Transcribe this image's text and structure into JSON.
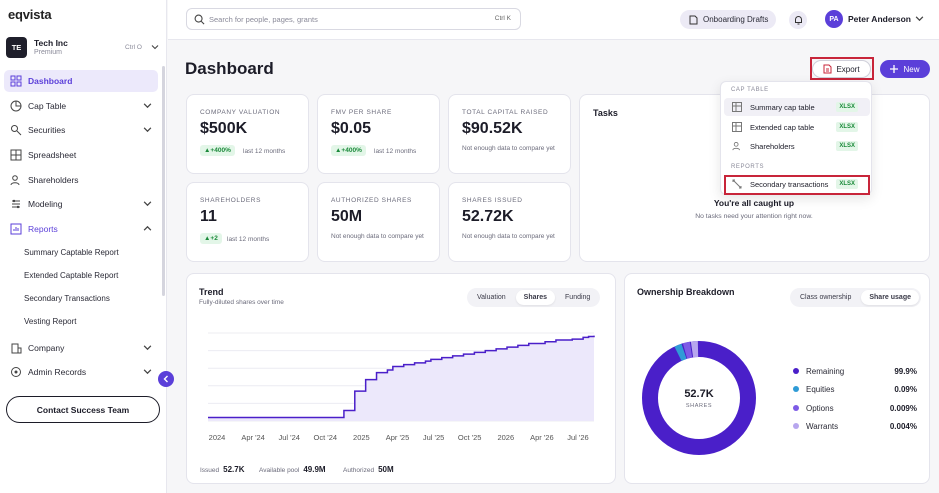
{
  "brand": {
    "logo": "eqvista"
  },
  "company": {
    "initials": "TE",
    "name": "Tech Inc",
    "plan": "Premium",
    "shortcut": "Ctrl O"
  },
  "nav": {
    "items": [
      "Dashboard",
      "Cap Table",
      "Securities",
      "Spreadsheet",
      "Shareholders",
      "Modeling",
      "Reports",
      "Company",
      "Admin Records"
    ],
    "reports_sub": [
      "Summary Captable Report",
      "Extended Captable Report",
      "Secondary Transactions",
      "Vesting Report"
    ],
    "contact": "Contact Success Team"
  },
  "search": {
    "placeholder": "Search for people, pages, grants",
    "shortcut": "Ctrl K"
  },
  "topbar": {
    "onboarding": "Onboarding Drafts",
    "user_initials": "PA",
    "user_name": "Peter Anderson"
  },
  "page": {
    "title": "Dashboard",
    "export": "Export",
    "new": "New"
  },
  "stats": [
    {
      "label": "COMPANY VALUATION",
      "value": "$500K",
      "badge": "▲+400%",
      "note": "last 12 months"
    },
    {
      "label": "FMV PER SHARE",
      "value": "$0.05",
      "badge": "▲+400%",
      "note": "last 12 months"
    },
    {
      "label": "TOTAL CAPITAL RAISED",
      "value": "$90.52K",
      "note": "Not enough data to compare yet"
    },
    {
      "label": "SHAREHOLDERS",
      "value": "11",
      "badge": "▲+2",
      "note": "last 12 months"
    },
    {
      "label": "AUTHORIZED SHARES",
      "value": "50M",
      "note": "Not enough data to compare yet"
    },
    {
      "label": "SHARES ISSUED",
      "value": "52.72K",
      "note": "Not enough data to compare yet"
    }
  ],
  "tasks": {
    "title": "Tasks",
    "empty_title": "You're all caught up",
    "empty_sub": "No tasks need your attention right now."
  },
  "export_menu": {
    "group1": "CAP TABLE",
    "items1": [
      {
        "label": "Summary cap table",
        "fmt": "XLSX"
      },
      {
        "label": "Extended cap table",
        "fmt": "XLSX"
      },
      {
        "label": "Shareholders",
        "fmt": "XLSX"
      }
    ],
    "group2": "REPORTS",
    "items2": [
      {
        "label": "Secondary transactions",
        "fmt": "XLSX"
      }
    ]
  },
  "trend": {
    "title": "Trend",
    "subtitle": "Fully-diluted shares over time",
    "tabs": [
      "Valuation",
      "Shares",
      "Funding"
    ],
    "active_tab": "Shares",
    "footer": [
      {
        "label": "Issued",
        "value": "52.7K"
      },
      {
        "label": "Available pool",
        "value": "49.9M"
      },
      {
        "label": "Authorized",
        "value": "50M"
      }
    ]
  },
  "ownership": {
    "title": "Ownership Breakdown",
    "tabs": [
      "Class ownership",
      "Share usage"
    ],
    "active_tab": "Share usage",
    "center_value": "52.7K",
    "center_label": "SHARES",
    "legend": [
      {
        "name": "Remaining",
        "pct": "99.9%",
        "color": "#4a1fc9"
      },
      {
        "name": "Equities",
        "pct": "0.09%",
        "color": "#2f9bd6"
      },
      {
        "name": "Options",
        "pct": "0.009%",
        "color": "#7d5be6"
      },
      {
        "name": "Warrants",
        "pct": "0.004%",
        "color": "#b7a6ee"
      }
    ]
  },
  "chart_data": {
    "type": "area",
    "x_ticks": [
      "2024",
      "Apr '24",
      "Jul '24",
      "Oct '24",
      "2025",
      "Apr '25",
      "Jul '25",
      "Oct '25",
      "2026",
      "Apr '26",
      "Jul '26"
    ],
    "series": [
      {
        "values": [
          0.04,
          0.04,
          0.04,
          0.04,
          0.04,
          0.04,
          0.04,
          0.04,
          0.04,
          0.04,
          0.04,
          0.04,
          0.04,
          0.04,
          0.04,
          0.04,
          0.04,
          0.04,
          0.04,
          0.04,
          0.04,
          0.04,
          0.04,
          0.04,
          0.04,
          0.12,
          0.12,
          0.34,
          0.34,
          0.47,
          0.47,
          0.55,
          0.55,
          0.58,
          0.62,
          0.62,
          0.64,
          0.64,
          0.66,
          0.66,
          0.68,
          0.7,
          0.7,
          0.72,
          0.72,
          0.74,
          0.74,
          0.76,
          0.76,
          0.78,
          0.78,
          0.8,
          0.8,
          0.82,
          0.82,
          0.84,
          0.84,
          0.86,
          0.86,
          0.88,
          0.88,
          0.88,
          0.9,
          0.9,
          0.92,
          0.92,
          0.92,
          0.93,
          0.93,
          0.95,
          0.96,
          0.97
        ]
      }
    ],
    "grid": true,
    "color": "#4a1fc9"
  }
}
